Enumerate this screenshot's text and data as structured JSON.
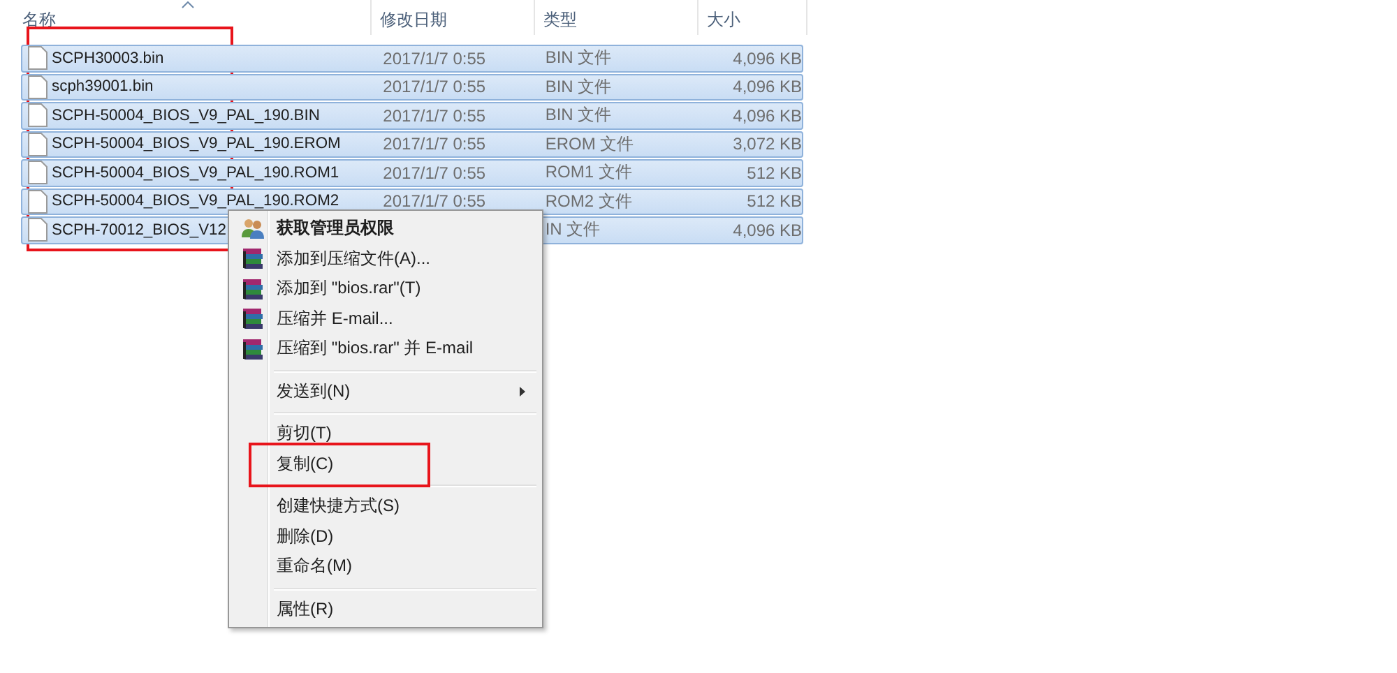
{
  "columns": [
    {
      "label": "名称",
      "sorted": true
    },
    {
      "label": "修改日期",
      "sorted": false
    },
    {
      "label": "类型",
      "sorted": false
    },
    {
      "label": "大小",
      "sorted": false
    }
  ],
  "files": [
    {
      "name": "SCPH30003.bin",
      "date": "2017/1/7 0:55",
      "type": "BIN 文件",
      "size": "4,096 KB",
      "selected": true
    },
    {
      "name": "scph39001.bin",
      "date": "2017/1/7 0:55",
      "type": "BIN 文件",
      "size": "4,096 KB",
      "selected": true
    },
    {
      "name": "SCPH-50004_BIOS_V9_PAL_190.BIN",
      "date": "2017/1/7 0:55",
      "type": "BIN 文件",
      "size": "4,096 KB",
      "selected": true
    },
    {
      "name": "SCPH-50004_BIOS_V9_PAL_190.EROM",
      "date": "2017/1/7 0:55",
      "type": "EROM 文件",
      "size": "3,072 KB",
      "selected": true
    },
    {
      "name": "SCPH-50004_BIOS_V9_PAL_190.ROM1",
      "date": "2017/1/7 0:55",
      "type": "ROM1 文件",
      "size": "512 KB",
      "selected": true
    },
    {
      "name": "SCPH-50004_BIOS_V9_PAL_190.ROM2",
      "date": "2017/1/7 0:55",
      "type": "ROM2 文件",
      "size": "512 KB",
      "selected": true
    },
    {
      "name": "SCPH-70012_BIOS_V12",
      "type": "IN 文件",
      "size": "4,096 KB",
      "selected": true
    }
  ],
  "context_menu": {
    "groups": [
      [
        {
          "kind": "admin",
          "label": "获取管理员权限",
          "default": true
        },
        {
          "kind": "archive",
          "label": "添加到压缩文件(A)...",
          "default": false
        },
        {
          "kind": "archive",
          "label": "添加到 \"bios.rar\"(T)",
          "default": false
        },
        {
          "kind": "archive",
          "label": "压缩并 E-mail...",
          "default": false
        },
        {
          "kind": "archive",
          "label": "压缩到 \"bios.rar\" 并 E-mail",
          "default": false
        }
      ],
      [
        {
          "kind": "submenu",
          "label": "发送到(N)",
          "default": false
        }
      ],
      [
        {
          "kind": "plain",
          "label": "剪切(T)",
          "default": false
        },
        {
          "kind": "plain",
          "label": "复制(C)",
          "default": false
        }
      ],
      [
        {
          "kind": "plain",
          "label": "创建快捷方式(S)",
          "default": false
        },
        {
          "kind": "plain",
          "label": "删除(D)",
          "default": false
        },
        {
          "kind": "plain",
          "label": "重命名(M)",
          "default": false
        }
      ],
      [
        {
          "kind": "plain",
          "label": "属性(R)",
          "default": false
        }
      ]
    ]
  }
}
